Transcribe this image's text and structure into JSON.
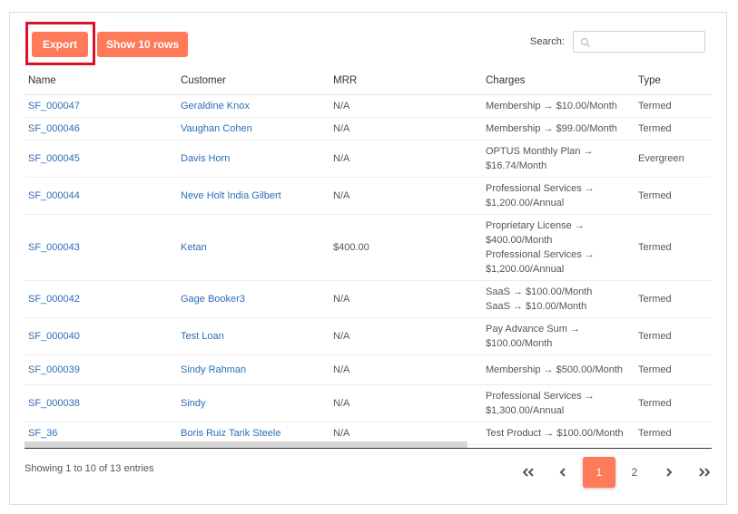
{
  "toolbar": {
    "export_label": "Export",
    "show_rows_label": "Show 10 rows",
    "search_label": "Search:",
    "search_value": "",
    "search_placeholder": ""
  },
  "table": {
    "columns": [
      "Name",
      "Customer",
      "MRR",
      "Charges",
      "Type"
    ],
    "rows": [
      {
        "name": "SF_000047",
        "customer": "Geraldine Knox",
        "mrr": "N/A",
        "charges": [
          "Membership → $10.00/Month"
        ],
        "type": "Termed"
      },
      {
        "name": "SF_000046",
        "customer": "Vaughan Cohen",
        "mrr": "N/A",
        "charges": [
          "Membership → $99.00/Month"
        ],
        "type": "Termed"
      },
      {
        "name": "SF_000045",
        "customer": "Davis Horn",
        "mrr": "N/A",
        "charges": [
          "OPTUS Monthly Plan →",
          "$16.74/Month"
        ],
        "type": "Evergreen"
      },
      {
        "name": "SF_000044",
        "customer": "Neve Holt India Gilbert",
        "mrr": "N/A",
        "charges": [
          "Professional Services →",
          "$1,200.00/Annual"
        ],
        "type": "Termed"
      },
      {
        "name": "SF_000043",
        "customer": "Ketan",
        "mrr": "$400.00",
        "charges": [
          "Proprietary License →",
          "$400.00/Month",
          "Professional Services →",
          "$1,200.00/Annual"
        ],
        "type": "Termed"
      },
      {
        "name": "SF_000042",
        "customer": "Gage Booker3",
        "mrr": "N/A",
        "charges": [
          "SaaS → $100.00/Month",
          "SaaS → $10.00/Month"
        ],
        "type": "Termed"
      },
      {
        "name": "SF_000040",
        "customer": "Test Loan",
        "mrr": "N/A",
        "charges": [
          "Pay Advance Sum →",
          "$100.00/Month"
        ],
        "type": "Termed"
      },
      {
        "name": "SF_000039",
        "customer": "Sindy Rahman",
        "mrr": "N/A",
        "charges": [
          "Membership → $500.00/Month"
        ],
        "type": "Termed"
      },
      {
        "name": "SF_000038",
        "customer": "Sindy",
        "mrr": "N/A",
        "charges": [
          "Professional Services →",
          "$1,300.00/Annual"
        ],
        "type": "Termed"
      },
      {
        "name": "SF_36",
        "customer": "Boris Ruiz Tarik Steele",
        "mrr": "N/A",
        "charges": [
          "Test Product → $100.00/Month"
        ],
        "type": "Termed"
      }
    ]
  },
  "footer": {
    "info": "Showing 1 to 10 of 13 entries",
    "pages": [
      "1",
      "2"
    ],
    "current_page": "1"
  },
  "colors": {
    "accent": "#ff7a59",
    "link": "#2f6db5",
    "highlight": "#d9122b"
  },
  "icons": {
    "search": "search-icon",
    "first": "double-chevron-left-icon",
    "prev": "chevron-left-icon",
    "next": "chevron-right-icon",
    "last": "double-chevron-right-icon"
  }
}
